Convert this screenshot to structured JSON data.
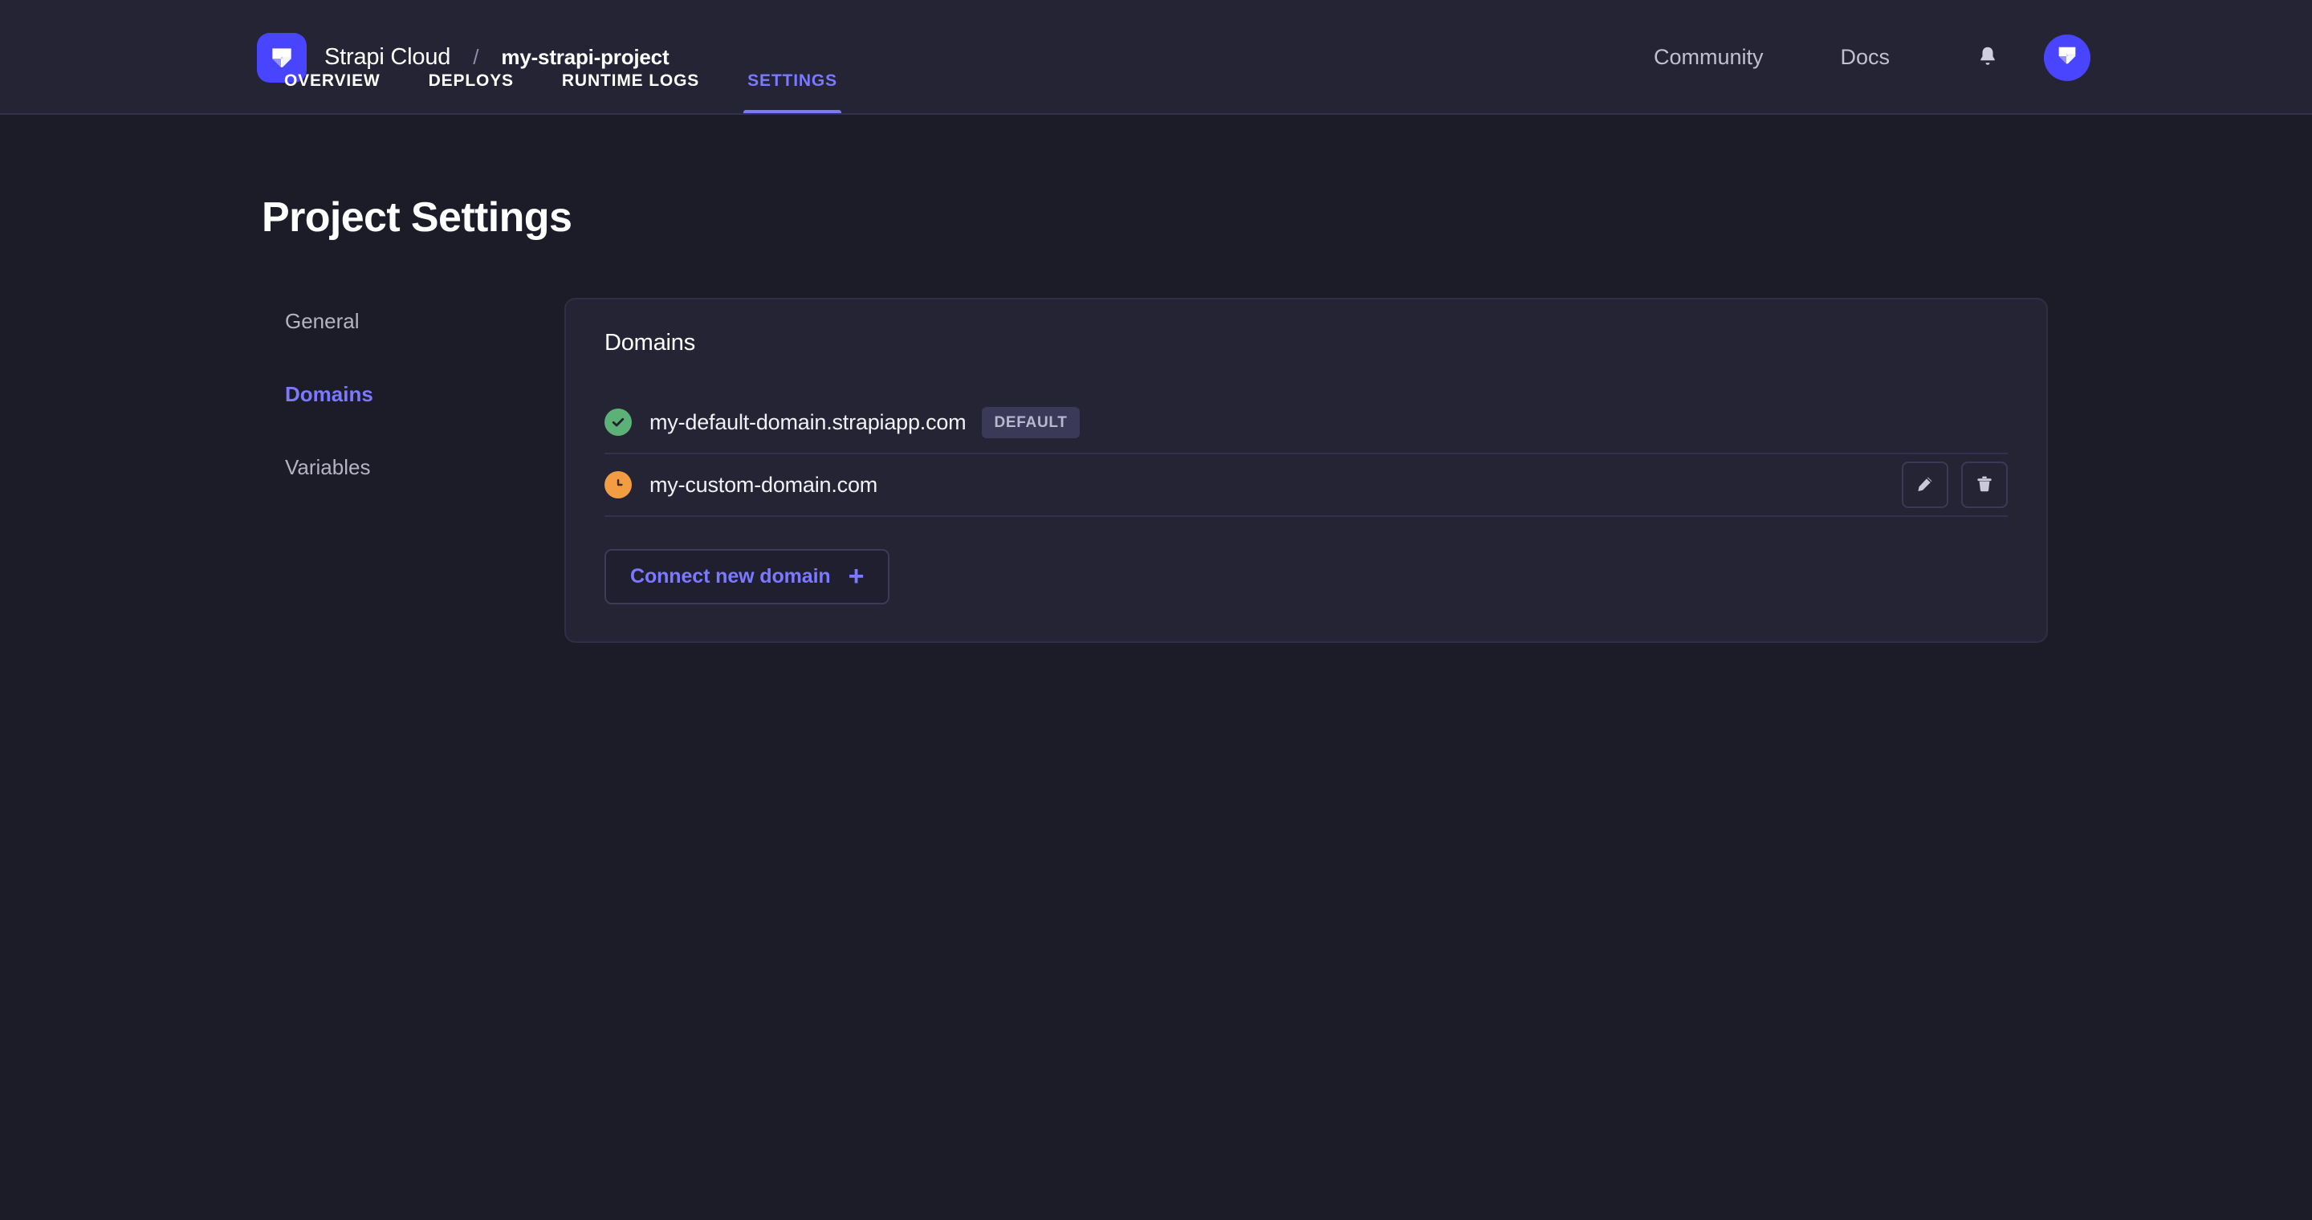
{
  "header": {
    "brand_name": "Strapi Cloud",
    "separator": "/",
    "project_name": "my-strapi-project",
    "logo_icon": "strapi-logo-icon",
    "links": [
      {
        "label": "Community",
        "name": "community-link"
      },
      {
        "label": "Docs",
        "name": "docs-link"
      }
    ],
    "notifications_icon": "bell-icon",
    "avatar_icon": "strapi-avatar-icon",
    "accent_color": "#4945ff"
  },
  "tabs": [
    {
      "label": "Overview",
      "active": false
    },
    {
      "label": "Deploys",
      "active": false
    },
    {
      "label": "Runtime Logs",
      "active": false
    },
    {
      "label": "Settings",
      "active": true
    }
  ],
  "page": {
    "title": "Project Settings"
  },
  "sidebar": {
    "items": [
      {
        "label": "General",
        "active": false
      },
      {
        "label": "Domains",
        "active": true
      },
      {
        "label": "Variables",
        "active": false
      }
    ]
  },
  "panel": {
    "title": "Domains",
    "rows": [
      {
        "name": "my-default-domain.strapiapp.com",
        "status": "verified",
        "status_icon": "check-circle-icon",
        "badge": "DEFAULT",
        "has_actions": false
      },
      {
        "name": "my-custom-domain.com",
        "status": "pending",
        "status_icon": "clock-icon",
        "badge": null,
        "has_actions": true
      }
    ],
    "actions": {
      "edit_icon": "pencil-icon",
      "delete_icon": "trash-icon"
    },
    "connect_button": {
      "label": "Connect new domain",
      "icon": "plus-icon"
    }
  },
  "colors": {
    "page_bg": "#1c1c29",
    "panel_bg": "#242435",
    "accent": "#7b79ff",
    "status_ok": "#5cb176",
    "status_pending": "#f29d41"
  }
}
